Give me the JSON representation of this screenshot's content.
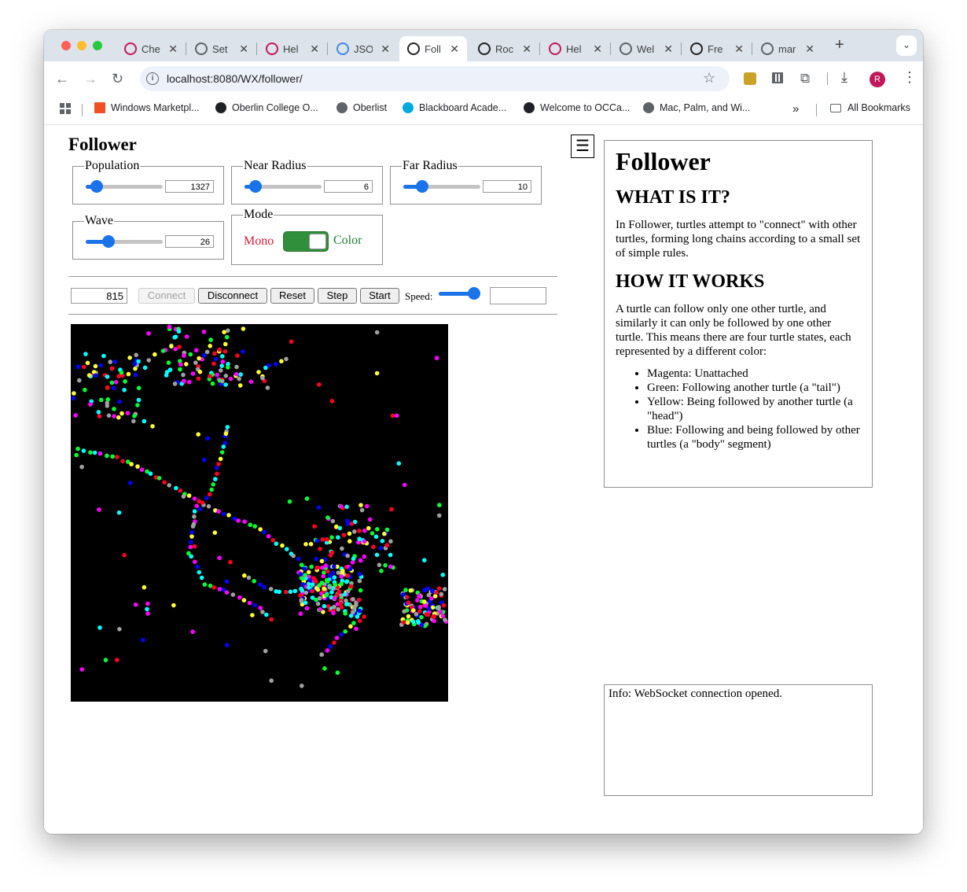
{
  "browser": {
    "tabs": [
      {
        "title": "Che",
        "favicon": "circle-swirl-icon",
        "color": "#c2185b"
      },
      {
        "title": "Set",
        "favicon": "gear-icon",
        "color": "#5f6368"
      },
      {
        "title": "Hel",
        "favicon": "circle-swirl-icon",
        "color": "#c2185b"
      },
      {
        "title": "JSO",
        "favicon": "google-icon",
        "color": "#4285f4"
      },
      {
        "title": "Foll",
        "favicon": "n-icon",
        "color": "#202124"
      },
      {
        "title": "Roc",
        "favicon": "n-icon",
        "color": "#202124"
      },
      {
        "title": "Hel",
        "favicon": "circle-swirl-icon",
        "color": "#c2185b"
      },
      {
        "title": "Wel",
        "favicon": "globe-icon",
        "color": "#5f6368"
      },
      {
        "title": "Fre",
        "favicon": "md-icon",
        "color": "#202124"
      },
      {
        "title": "mar",
        "favicon": "globe-icon",
        "color": "#5f6368"
      }
    ],
    "active_tab": 4,
    "url": "localhost:8080/WX/follower/",
    "profile_initial": "R",
    "bookmarks": [
      {
        "label": "Windows Marketpl...",
        "icon": "microsoft-icon"
      },
      {
        "label": "Oberlin College O...",
        "icon": "oberlin-icon"
      },
      {
        "label": "Oberlist",
        "icon": "globe-icon"
      },
      {
        "label": "Blackboard Acade...",
        "icon": "att-icon"
      },
      {
        "label": "Welcome to OCCa...",
        "icon": "oberlin-icon"
      },
      {
        "label": "Mac, Palm, and Wi...",
        "icon": "globe-icon"
      }
    ],
    "overflow_label": "»",
    "all_bookmarks_label": "All Bookmarks"
  },
  "app": {
    "title": "Follower",
    "menu_label": "☰",
    "controls": {
      "population": {
        "label": "Population",
        "value": "1327",
        "fraction": 0.14
      },
      "near_radius": {
        "label": "Near Radius",
        "value": "6",
        "fraction": 0.14
      },
      "far_radius": {
        "label": "Far Radius",
        "value": "10",
        "fraction": 0.24
      },
      "wave": {
        "label": "Wave",
        "value": "26",
        "fraction": 0.3
      },
      "mode": {
        "label": "Mode",
        "mono_label": "Mono",
        "color_label": "Color",
        "mono_color": "#d81b3b",
        "color_color": "#1e7e34",
        "on": true
      }
    },
    "runbar": {
      "counter": "815",
      "connect_label": "Connect",
      "disconnect_label": "Disconnect",
      "reset_label": "Reset",
      "step_label": "Step",
      "start_label": "Start",
      "speed_label": "Speed:",
      "speed_fraction": 0.9,
      "extra_value": ""
    },
    "info_message": "Info: WebSocket connection opened."
  },
  "doc": {
    "title": "Follower",
    "what_heading": "WHAT IS IT?",
    "what_text": "In Follower, turtles attempt to \"connect\" with other turtles, forming long chains according to a small set of simple rules.",
    "how_heading": "HOW IT WORKS",
    "how_text": "A turtle can follow only one other turtle, and similarly it can only be followed by one other turtle. This means there are four turtle states, each represented by a different color:",
    "states": [
      "Magenta: Unattached",
      "Green: Following another turtle (a \"tail\")",
      "Yellow: Being followed by another turtle (a \"head\")",
      "Blue: Following and being followed by other turtles (a \"body\" segment)"
    ]
  },
  "palette": {
    "turtle_colors": [
      "#ff00ff",
      "#00ff33",
      "#ffff33",
      "#0000ff",
      "#00ffff",
      "#ff0022",
      "#a0a0a0"
    ]
  }
}
